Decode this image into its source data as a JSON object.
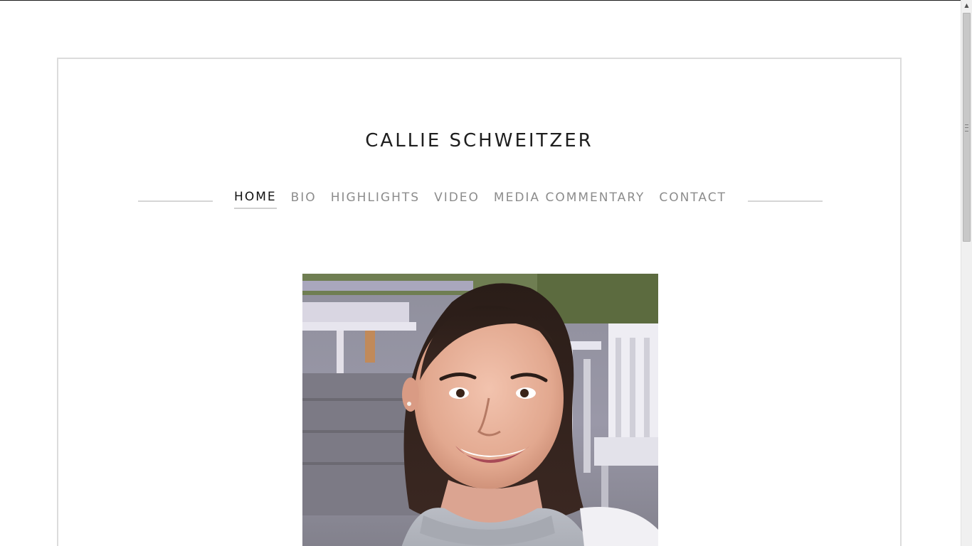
{
  "site": {
    "title": "CALLIE SCHWEITZER"
  },
  "nav": {
    "items": [
      {
        "label": "HOME",
        "active": true
      },
      {
        "label": "BIO",
        "active": false
      },
      {
        "label": "HIGHLIGHTS",
        "active": false
      },
      {
        "label": "VIDEO",
        "active": false
      },
      {
        "label": "MEDIA COMMENTARY",
        "active": false
      },
      {
        "label": "CONTACT",
        "active": false
      }
    ]
  },
  "hero": {
    "icon": "portrait-photo"
  },
  "colors": {
    "title_text": "#1e1e1e",
    "nav_active": "#111111",
    "nav_inactive": "#8c8c8c",
    "frame_border": "#dcdcdc"
  }
}
